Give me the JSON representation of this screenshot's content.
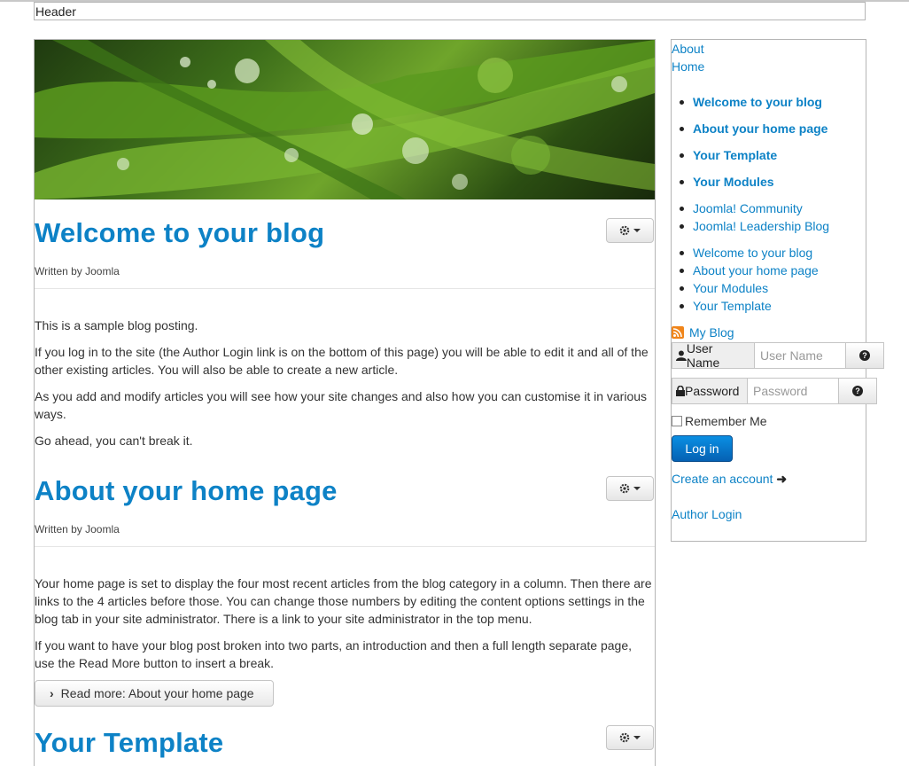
{
  "header": {
    "label": "Header"
  },
  "articles": [
    {
      "title": "Welcome to your blog",
      "byline": "Written by Joomla",
      "paragraphs": [
        "This is a sample blog posting.",
        "If you log in to the site (the Author Login link is on the bottom of this page) you will be able to edit it and all of the other existing articles. You will also be able to create a new article.",
        "As you add and modify articles you will see how your site changes and also how you can customise it in various ways.",
        "Go ahead, you can't break it."
      ]
    },
    {
      "title": "About your home page",
      "byline": "Written by Joomla",
      "paragraphs": [
        "Your home page is set to display the four most recent articles from the blog category in a column. Then there are links to the 4 articles before those. You can change those numbers by editing the content options settings in the blog tab in your site administrator. There is a link to your site administrator in the top menu.",
        "If you want to have your blog post broken into two parts, an introduction and then a full length separate page, use the Read More button to insert a break."
      ],
      "read_more": "Read more: About your home page"
    },
    {
      "title": "Your Template"
    }
  ],
  "sidebar": {
    "top_links": [
      "About",
      "Home"
    ],
    "bold_list": [
      "Welcome to your blog",
      "About your home page",
      "Your Template",
      "Your Modules"
    ],
    "external_list": [
      "Joomla! Community",
      "Joomla! Leadership Blog"
    ],
    "article_list": [
      "Welcome to your blog",
      "About your home page",
      "Your Modules",
      "Your Template"
    ],
    "rss_label": "My Blog",
    "login": {
      "username_label": "User Name",
      "username_placeholder": "User Name",
      "password_label": "Password",
      "password_placeholder": "Password",
      "remember_label": "Remember Me",
      "login_button": "Log in",
      "create_account": "Create an account",
      "author_login": "Author Login"
    }
  },
  "colors": {
    "link": "#0d82c6",
    "button": "#0561b3"
  }
}
